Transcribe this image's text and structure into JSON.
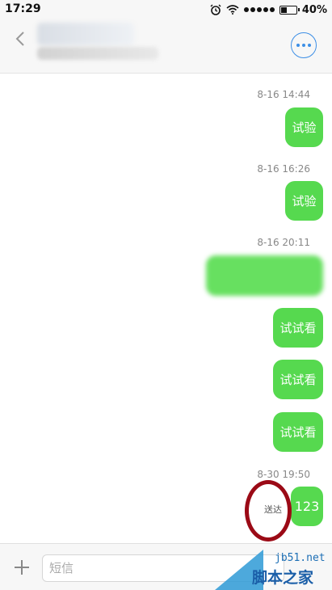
{
  "status_bar": {
    "time": "17:29",
    "battery": "40%",
    "battery_level": 0.4,
    "icons": [
      "alarm-icon",
      "wifi-icon",
      "signal-icon",
      "battery-icon"
    ]
  },
  "header": {
    "back_icon": "chevron-left-icon",
    "menu_icon": "more-options-icon",
    "accent_color": "#3d8fe6"
  },
  "conversation": {
    "bubble_color": "#56d94f",
    "groups": [
      {
        "timestamp": "8-16 14:44",
        "messages": [
          "试验"
        ]
      },
      {
        "timestamp": "8-16 16:26",
        "messages": [
          "试验"
        ]
      },
      {
        "timestamp": "8-16 20:11",
        "messages": [
          "试试看",
          "试试看",
          "试试看"
        ]
      },
      {
        "timestamp": "8-30 19:50",
        "messages": [
          "123"
        ],
        "status": "送达"
      }
    ]
  },
  "input_bar": {
    "placeholder": "短信",
    "add_icon": "plus-icon"
  },
  "watermark": {
    "url": "jb51.net",
    "text": "脚本之家"
  }
}
